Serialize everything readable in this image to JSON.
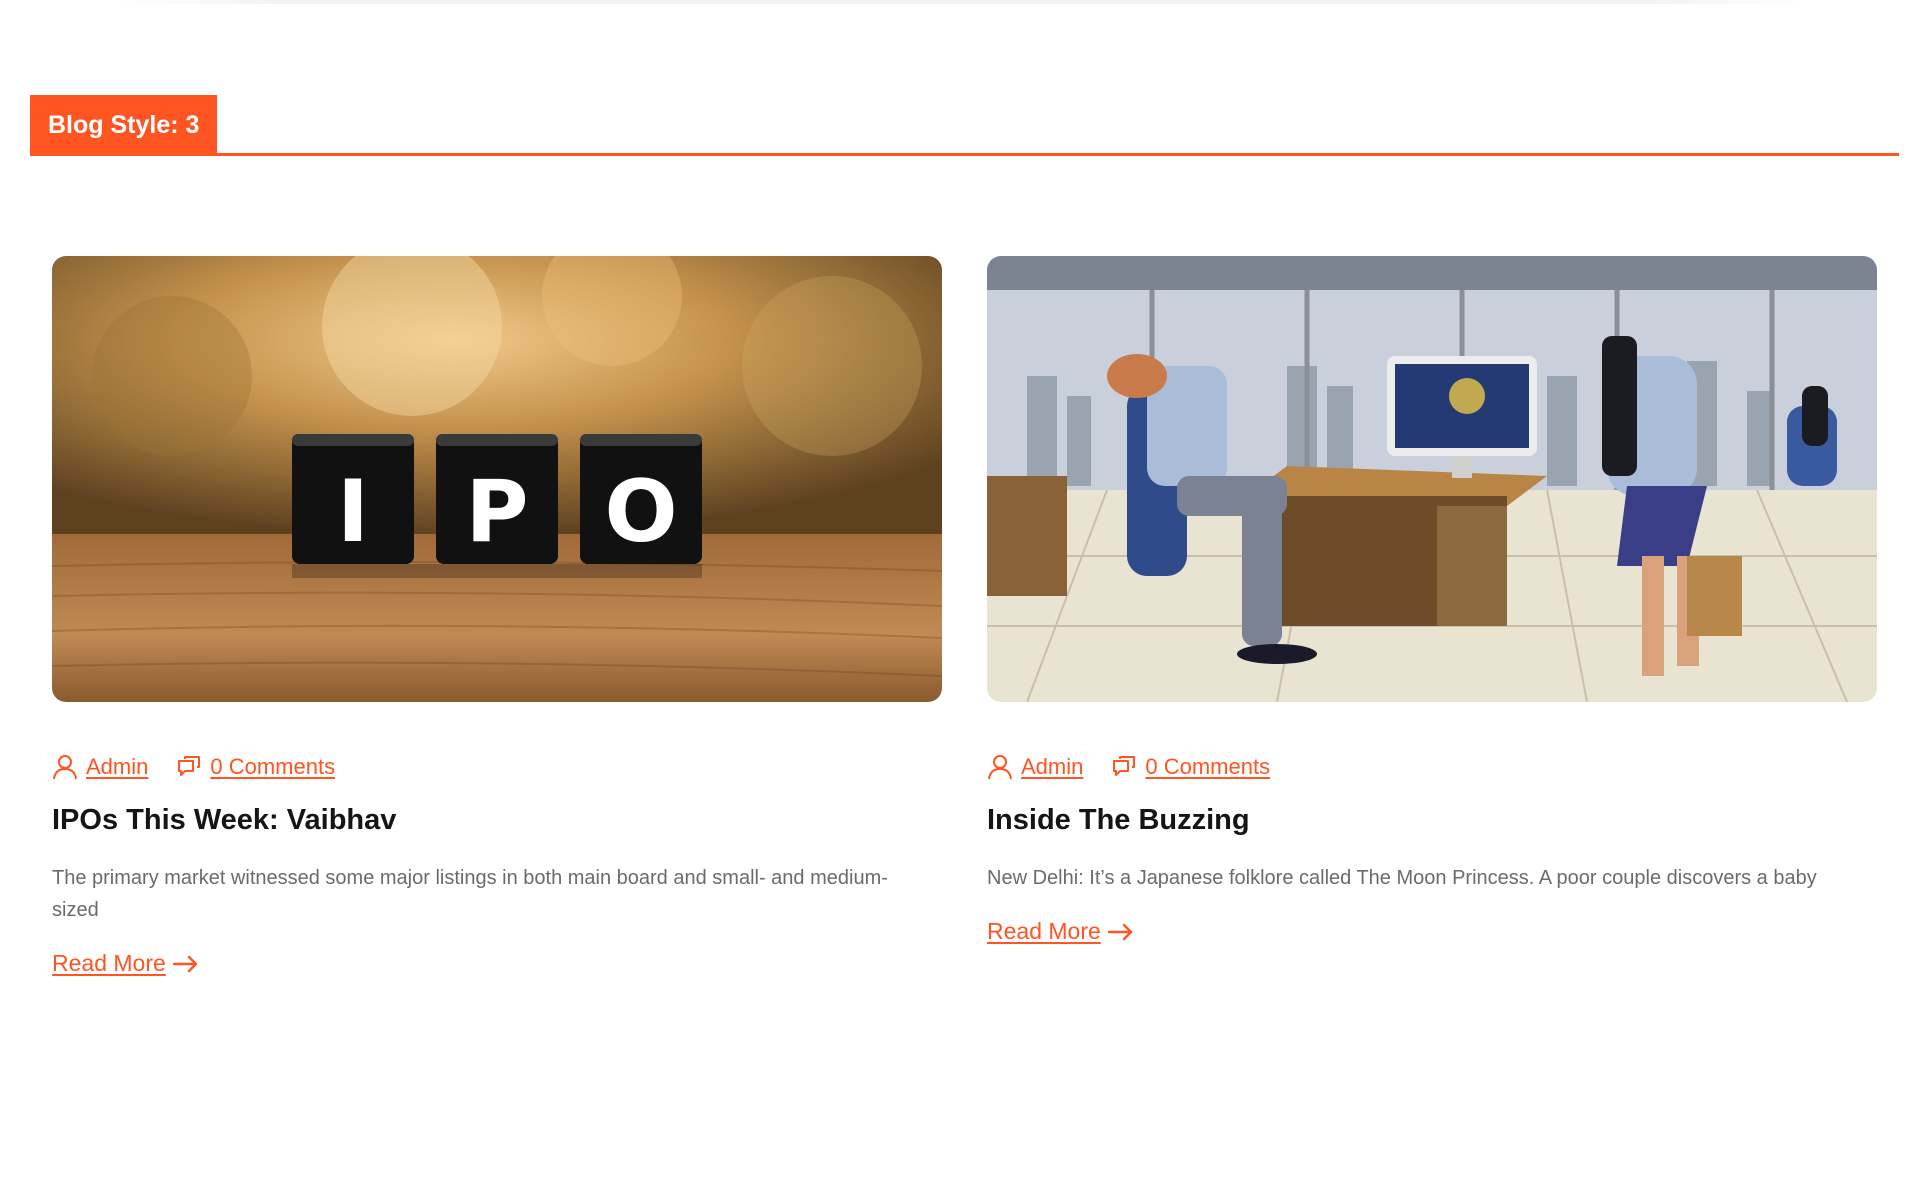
{
  "section": {
    "title": "Blog Style: 3",
    "accent_color": "#ff5522"
  },
  "posts": [
    {
      "image": "ipo-blocks-photo",
      "image_text": "IPO",
      "author": "Admin",
      "comments": "0 Comments",
      "title": "IPOs This Week: Vaibhav",
      "excerpt": "The primary market witnessed some major listings in both main board and small- and medium-sized",
      "read_more": "Read More"
    },
    {
      "image": "office-illustration",
      "author": "Admin",
      "comments": "0 Comments",
      "title": "Inside The Buzzing",
      "excerpt": "New Delhi: It’s a Japanese folklore called The Moon Princess. A poor couple discovers a baby",
      "read_more": "Read More"
    }
  ],
  "icons": {
    "author": "user-icon",
    "comments": "comments-icon",
    "read_more": "arrow-right-icon"
  }
}
